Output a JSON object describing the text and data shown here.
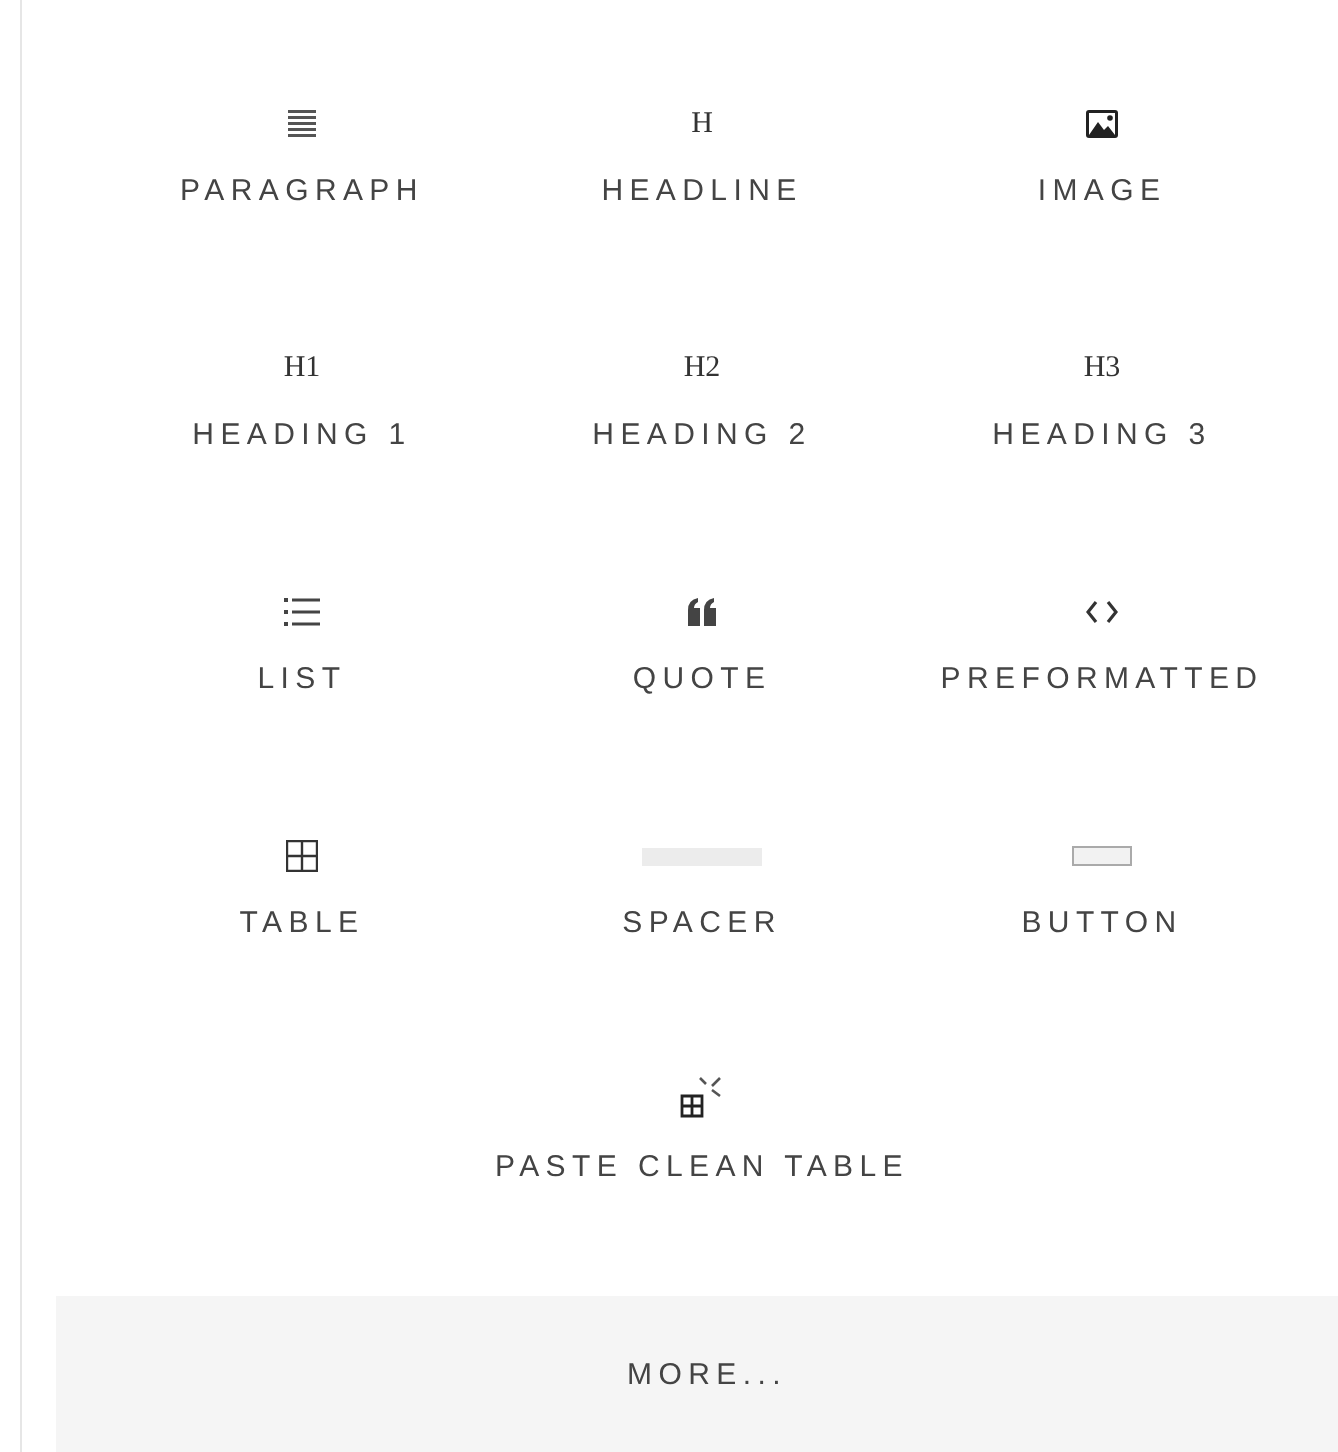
{
  "blocks": [
    {
      "label": "PARAGRAPH",
      "kind": "lines"
    },
    {
      "label": "HEADLINE",
      "kind": "glyph",
      "glyph": "H"
    },
    {
      "label": "IMAGE",
      "kind": "image"
    },
    {
      "label": "HEADING 1",
      "kind": "glyph",
      "glyph": "H1"
    },
    {
      "label": "HEADING 2",
      "kind": "glyph",
      "glyph": "H2"
    },
    {
      "label": "HEADING 3",
      "kind": "glyph",
      "glyph": "H3"
    },
    {
      "label": "LIST",
      "kind": "list"
    },
    {
      "label": "QUOTE",
      "kind": "quote"
    },
    {
      "label": "PREFORMATTED",
      "kind": "code"
    },
    {
      "label": "TABLE",
      "kind": "table"
    },
    {
      "label": "SPACER",
      "kind": "spacer"
    },
    {
      "label": "BUTTON",
      "kind": "button"
    },
    {
      "label": "PASTE CLEAN TABLE",
      "kind": "paste"
    }
  ],
  "more_button": "MORE..."
}
